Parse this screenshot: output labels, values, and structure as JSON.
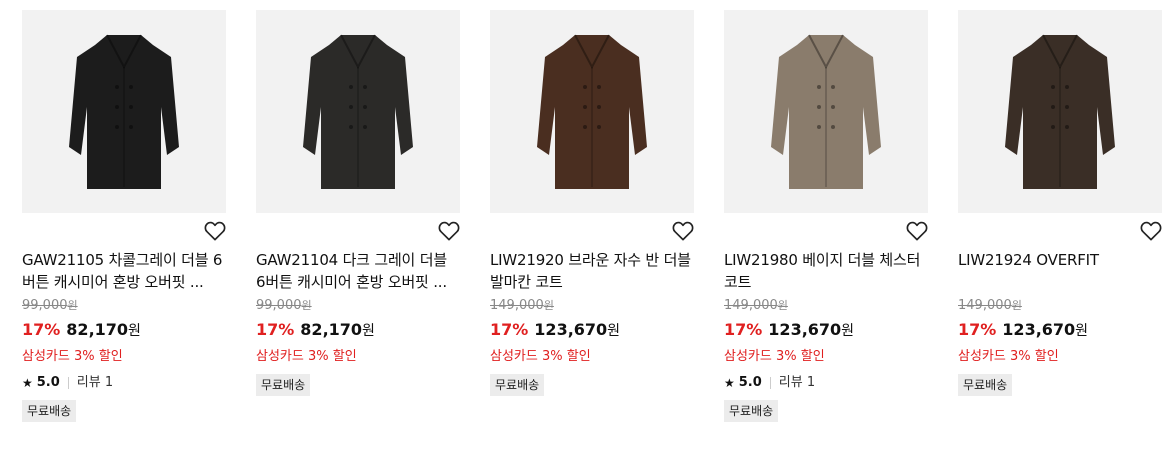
{
  "products": [
    {
      "name": "GAW21105 차콜그레이 더블 6버튼 캐시미어 혼방 오버핏 ...",
      "original_price": "99,000",
      "discount": "17%",
      "price": "82,170",
      "currency": "원",
      "card_discount": "삼성카드 3% 할인",
      "rating": "5.0",
      "review_label": "리뷰 1",
      "badge": "무료배송",
      "coat_color": "#1c1c1c"
    },
    {
      "name": "GAW21104 다크 그레이 더블 6버튼 캐시미어 혼방 오버핏 ...",
      "original_price": "99,000",
      "discount": "17%",
      "price": "82,170",
      "currency": "원",
      "card_discount": "삼성카드 3% 할인",
      "badge": "무료배송",
      "coat_color": "#2b2a28"
    },
    {
      "name": "LIW21920 브라운 자수 반 더블 발마칸 코트",
      "original_price": "149,000",
      "discount": "17%",
      "price": "123,670",
      "currency": "원",
      "card_discount": "삼성카드 3% 할인",
      "badge": "무료배송",
      "coat_color": "#4a2e20"
    },
    {
      "name": "LIW21980 베이지 더블 체스터 코트",
      "original_price": "149,000",
      "discount": "17%",
      "price": "123,670",
      "currency": "원",
      "card_discount": "삼성카드 3% 할인",
      "rating": "5.0",
      "review_label": "리뷰 1",
      "badge": "무료배송",
      "coat_color": "#8a7c6c"
    },
    {
      "name": "LIW21924 OVERFIT",
      "original_price": "149,000",
      "discount": "17%",
      "price": "123,670",
      "currency": "원",
      "card_discount": "삼성카드 3% 할인",
      "badge": "무료배송",
      "coat_color": "#3a2e26"
    }
  ],
  "colors": {
    "discount": "#e02020",
    "badge_bg": "#ececec",
    "image_bg": "#f2f2f2"
  }
}
